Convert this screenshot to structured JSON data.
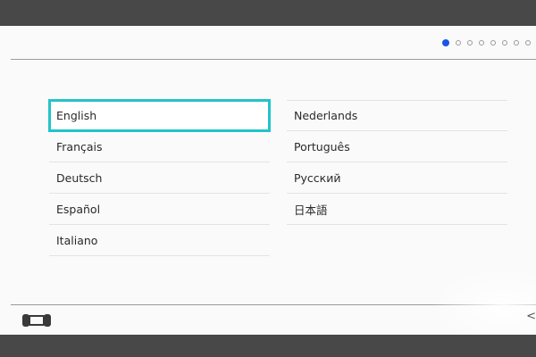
{
  "setup": {
    "progress": {
      "total_steps": 8,
      "current_step": 1
    },
    "languages_left": [
      {
        "label": "English",
        "selected": true
      },
      {
        "label": "Français",
        "selected": false
      },
      {
        "label": "Deutsch",
        "selected": false
      },
      {
        "label": "Español",
        "selected": false
      },
      {
        "label": "Italiano",
        "selected": false
      }
    ],
    "languages_right": [
      {
        "label": "Nederlands",
        "selected": false
      },
      {
        "label": "Português",
        "selected": false
      },
      {
        "label": "Русский",
        "selected": false
      },
      {
        "label": "日本語",
        "selected": false
      }
    ],
    "footer": {
      "console_icon": "handheld-console-icon",
      "back_icon": "chevron-left-icon",
      "back_glyph": "<"
    }
  },
  "colors": {
    "selection_outline": "#22c4c9",
    "active_dot": "#1a56e6",
    "screen_background": "#fbfafb",
    "frame_background": "#484848"
  }
}
